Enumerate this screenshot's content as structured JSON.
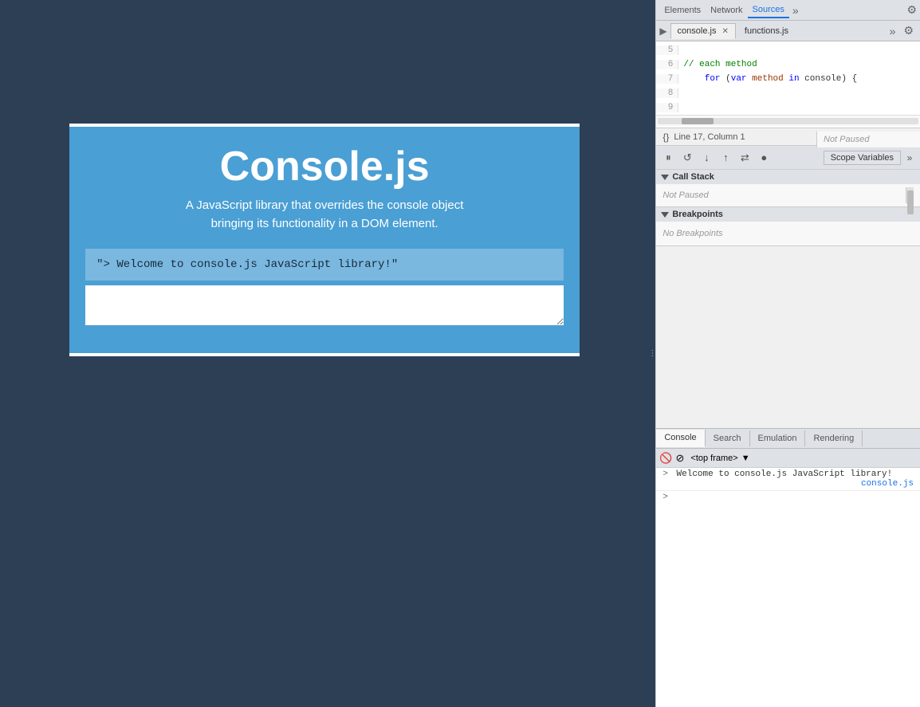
{
  "main_page": {
    "background_color": "#2d3f55"
  },
  "console_widget": {
    "title": "Console.js",
    "subtitle_line1": "A JavaScript library that overrides the console object",
    "subtitle_line2": "bringing its functionality in a DOM element.",
    "output_text": "\"> Welcome to console.js JavaScript library!\"",
    "input_placeholder": ""
  },
  "devtools": {
    "top_tabs": [
      {
        "label": "console.js",
        "active": true,
        "closeable": true
      },
      {
        "label": "functions.js",
        "active": false,
        "closeable": false
      }
    ],
    "code_lines": [
      {
        "num": "5",
        "content": ""
      },
      {
        "num": "6",
        "content": "    // each method",
        "type": "comment"
      },
      {
        "num": "7",
        "content": "    for (var method in console) {",
        "type": "code"
      },
      {
        "num": "8",
        "content": ""
      },
      {
        "num": "9",
        "content": ""
      }
    ],
    "status_bar": "Line 17, Column 1",
    "debugger_buttons": [
      {
        "icon": "⏸",
        "label": "pause",
        "name": "pause-btn"
      },
      {
        "icon": "↺",
        "label": "resume",
        "name": "resume-btn"
      },
      {
        "icon": "↓",
        "label": "step-into",
        "name": "step-into-btn"
      },
      {
        "icon": "↑",
        "label": "step-out",
        "name": "step-out-btn"
      },
      {
        "icon": "⇢",
        "label": "step-over",
        "name": "step-over-btn"
      },
      {
        "icon": "⏹",
        "label": "stop",
        "name": "stop-btn"
      }
    ],
    "scope_variables_btn": "Scope Variables",
    "call_stack": {
      "label": "Call Stack",
      "not_paused": "Not Paused"
    },
    "breakpoints": {
      "label": "Breakpoints",
      "no_breakpoints": "No Breakpoints"
    },
    "console_tabs": [
      {
        "label": "Console",
        "active": true
      },
      {
        "label": "Search",
        "active": false
      },
      {
        "label": "Emulation",
        "active": false
      },
      {
        "label": "Rendering",
        "active": false
      }
    ],
    "console_toolbar": {
      "clear_icon": "🚫",
      "filter_icon": "⊘",
      "frame_label": "<top frame>",
      "frame_arrow": "▼"
    },
    "console_output": [
      {
        "type": "log",
        "text": "> Welcome to console.js JavaScript library!",
        "link": "console.js"
      },
      {
        "type": "prompt",
        "text": ""
      }
    ],
    "nav_tabs": [
      {
        "label": "Elements",
        "active": false
      },
      {
        "label": "Network",
        "active": false
      },
      {
        "label": "Sources",
        "active": true
      }
    ]
  }
}
